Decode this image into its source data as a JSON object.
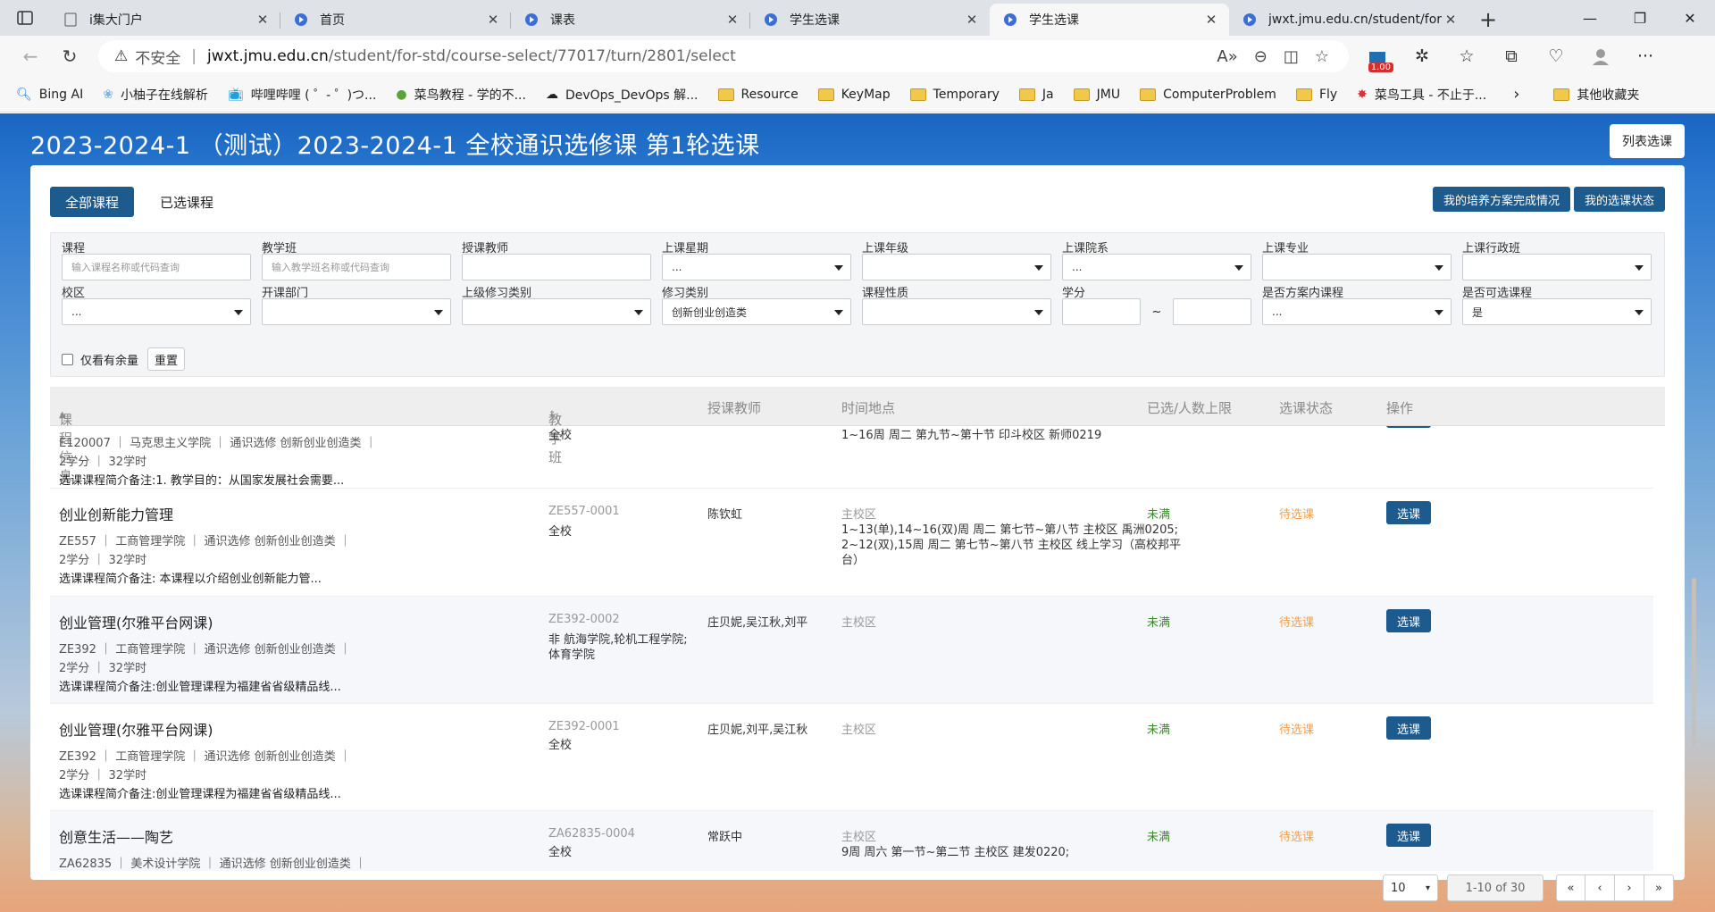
{
  "browser": {
    "tabs": [
      {
        "title": "i集大门户"
      },
      {
        "title": "首页"
      },
      {
        "title": "课表"
      },
      {
        "title": "学生选课"
      },
      {
        "title": "学生选课"
      },
      {
        "title": "jwxt.jmu.edu.cn/student/for"
      }
    ],
    "address": {
      "security": "不安全",
      "host": "jwxt.jmu.edu.cn",
      "path": "/student/for-std/course-select/77017/turn/2801/select"
    },
    "extension_badge": "1.00",
    "bookmarks": [
      {
        "label": "Bing AI",
        "icon": "search-icon"
      },
      {
        "label": "小柚子在线解析",
        "icon": "flower-icon"
      },
      {
        "label": "哔哩哔哩 ( ゜- ゜)つ...",
        "icon": "bilibili-icon"
      },
      {
        "label": "菜鸟教程 - 学的不...",
        "icon": "runoob-icon"
      },
      {
        "label": "DevOps_DevOps 解...",
        "icon": "cloud-icon"
      },
      {
        "label": "Resource",
        "icon": "folder-icon"
      },
      {
        "label": "KeyMap",
        "icon": "folder-icon"
      },
      {
        "label": "Temporary",
        "icon": "folder-icon"
      },
      {
        "label": "Ja",
        "icon": "folder-icon"
      },
      {
        "label": "JMU",
        "icon": "folder-icon"
      },
      {
        "label": "ComputerProblem",
        "icon": "folder-icon"
      },
      {
        "label": "Fly",
        "icon": "folder-icon"
      },
      {
        "label": "菜鸟工具 - 不止于...",
        "icon": "tool-icon"
      }
    ],
    "other_bookmarks": "其他收藏夹"
  },
  "page": {
    "title": "2023-2024-1 （测试）2023-2024-1 全校通识选修课 第1轮选课",
    "list_button": "列表选课",
    "tabs": [
      "全部课程",
      "已选课程"
    ],
    "actions": [
      "我的培养方案完成情况",
      "我的选课状态"
    ]
  },
  "filters": {
    "row1": [
      {
        "label": "课程",
        "value": "输入课程名称或代码查询",
        "type": "text"
      },
      {
        "label": "教学班",
        "value": "输入教学班名称或代码查询",
        "type": "text"
      },
      {
        "label": "授课教师",
        "value": "",
        "type": "text"
      },
      {
        "label": "上课星期",
        "value": "...",
        "type": "select"
      },
      {
        "label": "上课年级",
        "value": "",
        "type": "select"
      },
      {
        "label": "上课院系",
        "value": "...",
        "type": "select"
      },
      {
        "label": "上课专业",
        "value": "",
        "type": "select"
      },
      {
        "label": "上课行政班",
        "value": "",
        "type": "select"
      }
    ],
    "row2": [
      {
        "label": "校区",
        "value": "...",
        "type": "select"
      },
      {
        "label": "开课部门",
        "value": "",
        "type": "select"
      },
      {
        "label": "上级修习类别",
        "value": "",
        "type": "select"
      },
      {
        "label": "修习类别",
        "value": "创新创业创造类",
        "type": "select"
      },
      {
        "label": "课程性质",
        "value": "",
        "type": "select"
      },
      {
        "label": "学分",
        "value": "",
        "type": "range",
        "sep": "~"
      },
      {
        "label": "是否方案内课程",
        "value": "...",
        "type": "select"
      },
      {
        "label": "是否可选课程",
        "value": "是",
        "type": "select"
      }
    ],
    "only_available": "仅看有余量",
    "reset": "重置"
  },
  "table": {
    "headers": [
      "课程信息",
      "教学班",
      "授课教师",
      "时间地点",
      "已选/人数上限",
      "选课状态",
      "操作"
    ],
    "rows": [
      {
        "name": "",
        "meta": "E120007 ｜ 马克思主义学院 ｜ 通识选修  创新创业创造类 ｜",
        "credits": "2学分 ｜ 32学时",
        "desc": "选课课程简介备注:1. 教学目的：从国家发展社会需要...",
        "code": "",
        "scope": "全校",
        "teacher": "",
        "campus": "",
        "time": "1~16周 周二 第九节~第十节 印斗校区 新师0219",
        "count": "",
        "state": "",
        "op": ""
      },
      {
        "name": "创业创新能力管理",
        "meta": "ZE557 ｜ 工商管理学院 ｜ 通识选修  创新创业创造类 ｜",
        "credits": "2学分 ｜ 32学时",
        "desc": "选课课程简介备注:      本课程以介绍创业创新能力管...",
        "code": "ZE557-0001",
        "scope": "全校",
        "teacher": "陈钦虹",
        "campus": "主校区",
        "time": "1~13(单),14~16(双)周 周二 第七节~第八节 主校区 禹洲0205; 2~12(双),15周 周二 第七节~第八节 主校区 线上学习（高校邦平台）",
        "count": "未满",
        "state": "待选课",
        "op": "选课"
      },
      {
        "name": "创业管理(尔雅平台网课)",
        "meta": "ZE392 ｜ 工商管理学院 ｜ 通识选修  创新创业创造类 ｜",
        "credits": "2学分 ｜ 32学时",
        "desc": "选课课程简介备注:创业管理课程为福建省省级精品线...",
        "code": "ZE392-0002",
        "scope": "非 航海学院,轮机工程学院; 体育学院",
        "teacher": "庄贝妮,吴江秋,刘平",
        "campus": "主校区",
        "time": "",
        "count": "未满",
        "state": "待选课",
        "op": "选课"
      },
      {
        "name": "创业管理(尔雅平台网课)",
        "meta": "ZE392 ｜ 工商管理学院 ｜ 通识选修  创新创业创造类 ｜",
        "credits": "2学分 ｜ 32学时",
        "desc": "选课课程简介备注:创业管理课程为福建省省级精品线...",
        "code": "ZE392-0001",
        "scope": "全校",
        "teacher": "庄贝妮,刘平,吴江秋",
        "campus": "主校区",
        "time": "",
        "count": "未满",
        "state": "待选课",
        "op": "选课"
      },
      {
        "name": "创意生活——陶艺",
        "meta": "ZA62835 ｜ 美术设计学院 ｜ 通识选修  创新创业创造类 ｜",
        "credits": "",
        "desc": "",
        "code": "ZA62835-0004",
        "scope": "全校",
        "teacher": "常跃中",
        "campus": "主校区",
        "time": "9周 周六 第一节~第二节 主校区 建发0220;",
        "count": "未满",
        "state": "待选课",
        "op": "选课"
      }
    ]
  },
  "pagination": {
    "page_size": "10",
    "range": "1-10 of 30",
    "first": "«",
    "prev": "‹",
    "next": "›",
    "last": "»"
  }
}
